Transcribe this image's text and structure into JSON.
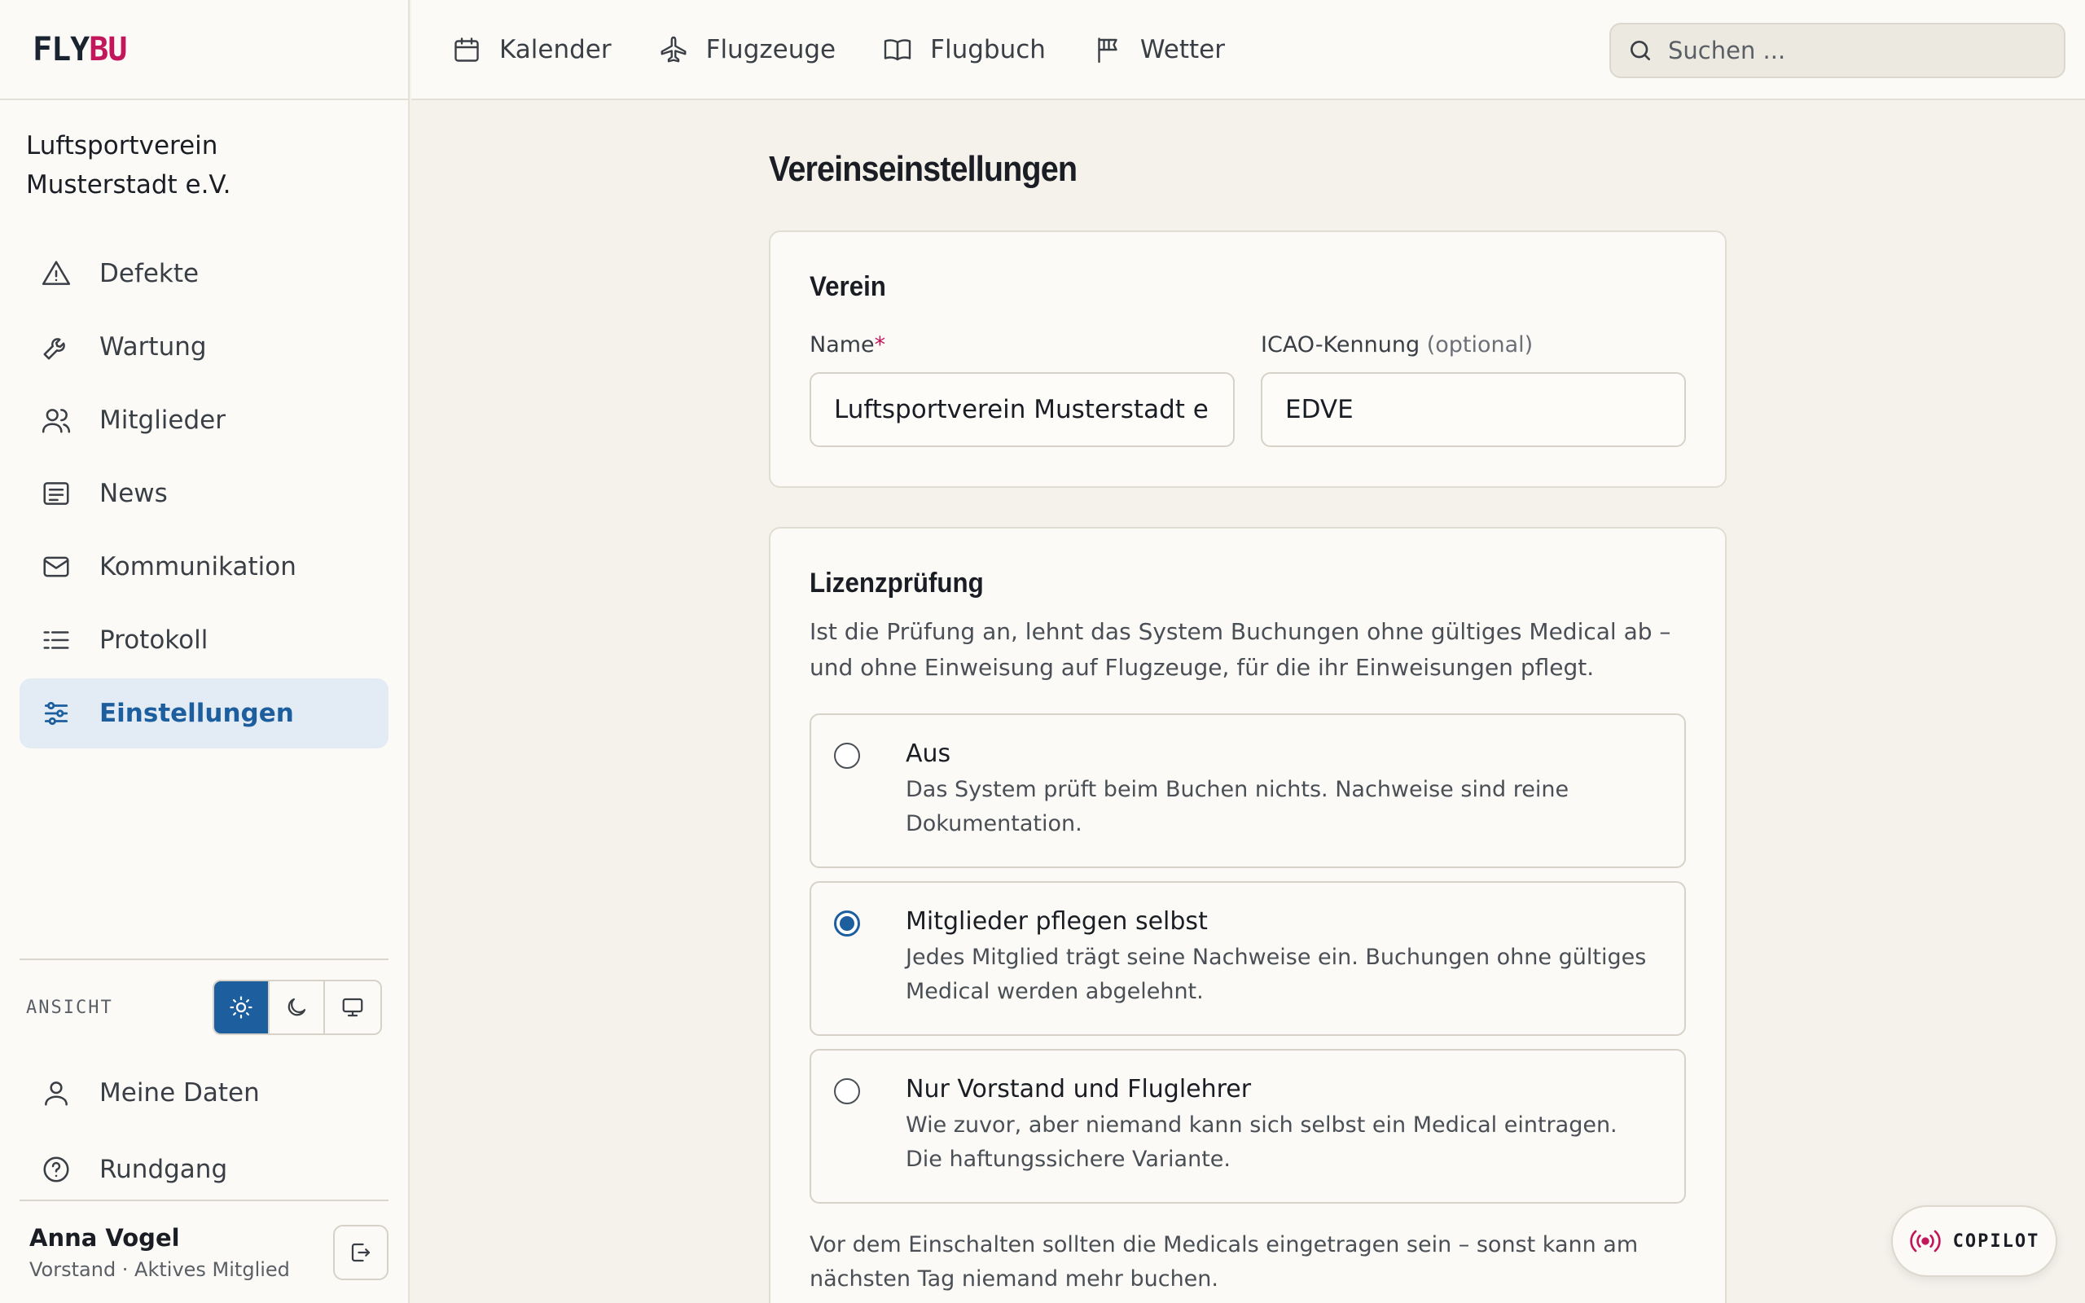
{
  "app": {
    "logo_fly": "FLY",
    "logo_bu": "BU",
    "club_name": "Luftsportverein Musterstadt e.V."
  },
  "topnav": {
    "items": [
      {
        "label": "Kalender",
        "icon": "calendar-icon"
      },
      {
        "label": "Flugzeuge",
        "icon": "plane-icon"
      },
      {
        "label": "Flugbuch",
        "icon": "book-icon"
      },
      {
        "label": "Wetter",
        "icon": "flag-icon"
      }
    ],
    "search_placeholder": "Suchen ..."
  },
  "sidebar": {
    "items": [
      {
        "label": "Defekte",
        "icon": "warning-icon"
      },
      {
        "label": "Wartung",
        "icon": "wrench-icon"
      },
      {
        "label": "Mitglieder",
        "icon": "users-icon"
      },
      {
        "label": "News",
        "icon": "news-icon"
      },
      {
        "label": "Kommunikation",
        "icon": "mail-icon"
      },
      {
        "label": "Protokoll",
        "icon": "list-icon"
      },
      {
        "label": "Einstellungen",
        "icon": "sliders-icon",
        "active": true
      }
    ],
    "view_label": "ANSICHT",
    "theme_options": [
      "light",
      "dark",
      "system"
    ],
    "theme_selected": "light",
    "bottom_items": [
      {
        "label": "Meine Daten",
        "icon": "user-icon"
      },
      {
        "label": "Rundgang",
        "icon": "help-icon"
      }
    ],
    "user": {
      "name": "Anna Vogel",
      "role": "Vorstand · Aktives Mitglied"
    }
  },
  "page": {
    "title": "Vereinseinstellungen",
    "verein": {
      "title": "Verein",
      "name_label": "Name",
      "name_required": "*",
      "name_value": "Luftsportverein Musterstadt e.V.",
      "icao_label": "ICAO-Kennung",
      "icao_optional": "(optional)",
      "icao_value": "EDVE"
    },
    "lizenz": {
      "title": "Lizenzprüfung",
      "description": "Ist die Prüfung an, lehnt das System Buchungen ohne gültiges Medical ab – und ohne Einweisung auf Flugzeuge, für die ihr Einweisungen pflegt.",
      "options": [
        {
          "title": "Aus",
          "description": "Das System prüft beim Buchen nichts. Nachweise sind reine Dokumentation.",
          "checked": false
        },
        {
          "title": "Mitglieder pflegen selbst",
          "description": "Jedes Mitglied trägt seine Nachweise ein. Buchungen ohne gültiges Medical werden abgelehnt.",
          "checked": true
        },
        {
          "title": "Nur Vorstand und Fluglehrer",
          "description": "Wie zuvor, aber niemand kann sich selbst ein Medical eintragen. Die haftungssichere Variante.",
          "checked": false
        }
      ],
      "note": "Vor dem Einschalten sollten die Medicals eingetragen sein – sonst kann am nächsten Tag niemand mehr buchen."
    }
  },
  "copilot": {
    "label": "COPILOT"
  },
  "colors": {
    "accent": "#1d5e9e",
    "brand": "#c2185b",
    "background": "#f4f2eb",
    "surface": "#fbfaf6"
  }
}
